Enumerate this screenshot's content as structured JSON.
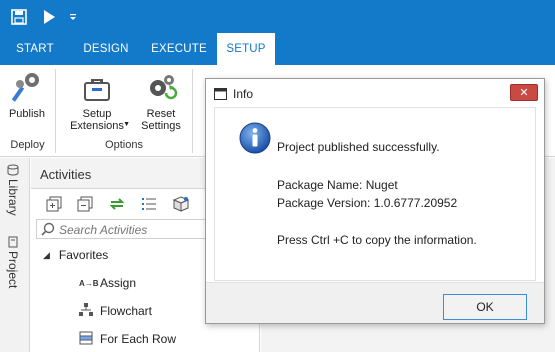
{
  "tabs": [
    {
      "label": "START"
    },
    {
      "label": "DESIGN"
    },
    {
      "label": "EXECUTE"
    },
    {
      "label": "SETUP",
      "active": true
    }
  ],
  "ribbon": {
    "publish_label": "Publish",
    "setup_extensions_label": "Setup\nExtensions",
    "reset_settings_label": "Reset\nSettings",
    "group_deploy": "Deploy",
    "group_options": "Options"
  },
  "side_tabs": {
    "library": "Library",
    "project": "Project"
  },
  "activities": {
    "title": "Activities",
    "search_placeholder": "Search Activities",
    "favorites": "Favorites",
    "items": [
      {
        "label": "Assign",
        "icon": "assign-icon"
      },
      {
        "label": "Flowchart",
        "icon": "flowchart-icon"
      },
      {
        "label": "For Each Row",
        "icon": "foreach-row-icon"
      }
    ]
  },
  "dialog": {
    "title": "Info",
    "message_line1": "Project published successfully.",
    "package_name": "Package Name: Nuget",
    "package_version": "Package Version: 1.0.6777.20952",
    "copy_hint": "Press Ctrl +C to copy the information.",
    "ok_label": "OK"
  },
  "colors": {
    "accent": "#1379c9",
    "close": "#c94a43"
  }
}
